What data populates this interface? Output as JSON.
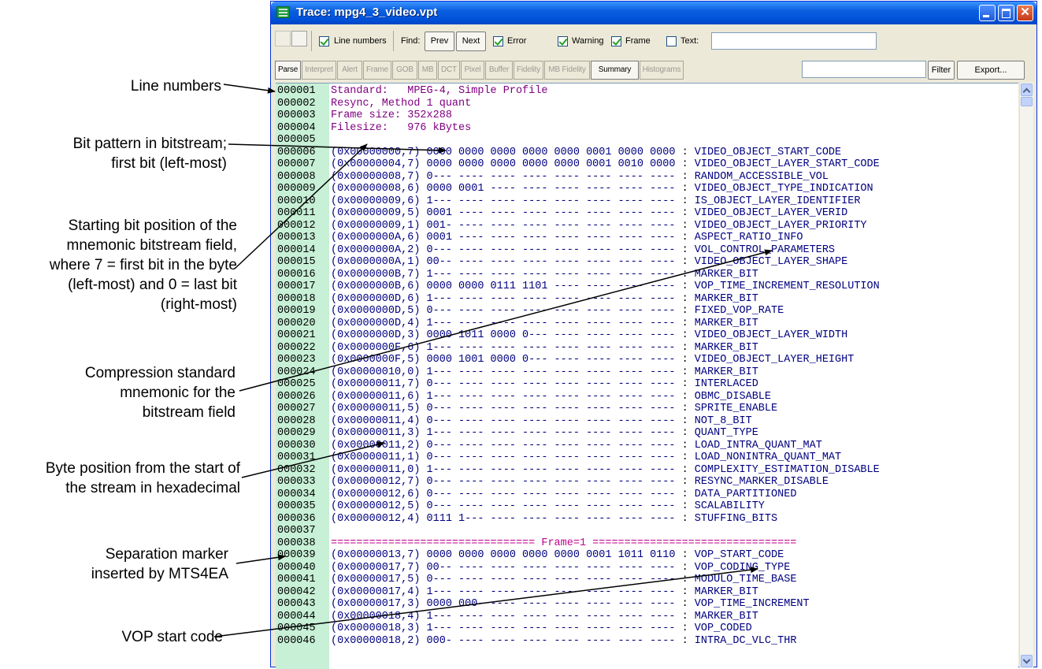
{
  "window": {
    "title": "Trace: mpg4_3_video.vpt",
    "icon": "table-icon",
    "title_color": "#ffffff",
    "titlebar_color": "#0a5fe0"
  },
  "toolbar1": {
    "line_numbers_label": "Line numbers",
    "line_numbers_checked": true,
    "find_label": "Find:",
    "prev_label": "Prev",
    "next_label": "Next",
    "error_label": "Error",
    "error_checked": true,
    "warning_label": "Warning",
    "warning_checked": true,
    "frame_label": "Frame",
    "frame_checked": true,
    "text_label": "Text:",
    "text_checked": false
  },
  "tabs": [
    {
      "label": "Parse",
      "enabled": true
    },
    {
      "label": "Interpret",
      "enabled": false
    },
    {
      "label": "Alert",
      "enabled": false
    },
    {
      "label": "Frame",
      "enabled": false
    },
    {
      "label": "GOB",
      "enabled": false
    },
    {
      "label": "MB",
      "enabled": false
    },
    {
      "label": "DCT",
      "enabled": false
    },
    {
      "label": "Pixel",
      "enabled": false
    },
    {
      "label": "Buffer",
      "enabled": false
    },
    {
      "label": "Fidelity",
      "enabled": false
    },
    {
      "label": "MB Fidelity",
      "enabled": false
    },
    {
      "label": "Summary",
      "enabled": true
    },
    {
      "label": "Histograms",
      "enabled": false
    }
  ],
  "toolbar2": {
    "filter_label": "Filter",
    "export_label": "Export..."
  },
  "header_lines": [
    {
      "num": "000001",
      "text": "Standard:   MPEG-4, Simple Profile"
    },
    {
      "num": "000002",
      "text": "Resync, Method 1 quant"
    },
    {
      "num": "000003",
      "text": "Frame size: 352x288"
    },
    {
      "num": "000004",
      "text": "Filesize:   976 kBytes"
    },
    {
      "num": "000005",
      "text": ""
    }
  ],
  "trace_lines": [
    {
      "num": "000006",
      "off": "(0x00000000,7)",
      "bits": "0000 0000 0000 0000 0000 0001 0000 0000",
      "mnemonic": "VIDEO_OBJECT_START_CODE"
    },
    {
      "num": "000007",
      "off": "(0x00000004,7)",
      "bits": "0000 0000 0000 0000 0000 0001 0010 0000",
      "mnemonic": "VIDEO_OBJECT_LAYER_START_CODE"
    },
    {
      "num": "000008",
      "off": "(0x00000008,7)",
      "bits": "0--- ---- ---- ---- ---- ---- ---- ----",
      "mnemonic": "RANDOM_ACCESSIBLE_VOL"
    },
    {
      "num": "000009",
      "off": "(0x00000008,6)",
      "bits": "0000 0001 ---- ---- ---- ---- ---- ----",
      "mnemonic": "VIDEO_OBJECT_TYPE_INDICATION"
    },
    {
      "num": "000010",
      "off": "(0x00000009,6)",
      "bits": "1--- ---- ---- ---- ---- ---- ---- ----",
      "mnemonic": "IS_OBJECT_LAYER_IDENTIFIER"
    },
    {
      "num": "000011",
      "off": "(0x00000009,5)",
      "bits": "0001 ---- ---- ---- ---- ---- ---- ----",
      "mnemonic": "VIDEO_OBJECT_LAYER_VERID"
    },
    {
      "num": "000012",
      "off": "(0x00000009,1)",
      "bits": "001- ---- ---- ---- ---- ---- ---- ----",
      "mnemonic": "VIDEO_OBJECT_LAYER_PRIORITY"
    },
    {
      "num": "000013",
      "off": "(0x0000000A,6)",
      "bits": "0001 ---- ---- ---- ---- ---- ---- ----",
      "mnemonic": "ASPECT_RATIO_INFO"
    },
    {
      "num": "000014",
      "off": "(0x0000000A,2)",
      "bits": "0--- ---- ---- ---- ---- ---- ---- ----",
      "mnemonic": "VOL_CONTROL_PARAMETERS"
    },
    {
      "num": "000015",
      "off": "(0x0000000A,1)",
      "bits": "00-- ---- ---- ---- ---- ---- ---- ----",
      "mnemonic": "VIDEO_OBJECT_LAYER_SHAPE"
    },
    {
      "num": "000016",
      "off": "(0x0000000B,7)",
      "bits": "1--- ---- ---- ---- ---- ---- ---- ----",
      "mnemonic": "MARKER_BIT"
    },
    {
      "num": "000017",
      "off": "(0x0000000B,6)",
      "bits": "0000 0000 0111 1101 ---- ---- ---- ----",
      "mnemonic": "VOP_TIME_INCREMENT_RESOLUTION"
    },
    {
      "num": "000018",
      "off": "(0x0000000D,6)",
      "bits": "1--- ---- ---- ---- ---- ---- ---- ----",
      "mnemonic": "MARKER_BIT"
    },
    {
      "num": "000019",
      "off": "(0x0000000D,5)",
      "bits": "0--- ---- ---- ---- ---- ---- ---- ----",
      "mnemonic": "FIXED_VOP_RATE"
    },
    {
      "num": "000020",
      "off": "(0x0000000D,4)",
      "bits": "1--- ---- ---- ---- ---- ---- ---- ----",
      "mnemonic": "MARKER_BIT"
    },
    {
      "num": "000021",
      "off": "(0x0000000D,3)",
      "bits": "0000 1011 0000 0--- ---- ---- ---- ----",
      "mnemonic": "VIDEO_OBJECT_LAYER_WIDTH"
    },
    {
      "num": "000022",
      "off": "(0x0000000F,6)",
      "bits": "1--- ---- ---- ---- ---- ---- ---- ----",
      "mnemonic": "MARKER_BIT"
    },
    {
      "num": "000023",
      "off": "(0x0000000F,5)",
      "bits": "0000 1001 0000 0--- ---- ---- ---- ----",
      "mnemonic": "VIDEO_OBJECT_LAYER_HEIGHT"
    },
    {
      "num": "000024",
      "off": "(0x00000010,0)",
      "bits": "1--- ---- ---- ---- ---- ---- ---- ----",
      "mnemonic": "MARKER_BIT"
    },
    {
      "num": "000025",
      "off": "(0x00000011,7)",
      "bits": "0--- ---- ---- ---- ---- ---- ---- ----",
      "mnemonic": "INTERLACED"
    },
    {
      "num": "000026",
      "off": "(0x00000011,6)",
      "bits": "1--- ---- ---- ---- ---- ---- ---- ----",
      "mnemonic": "OBMC_DISABLE"
    },
    {
      "num": "000027",
      "off": "(0x00000011,5)",
      "bits": "0--- ---- ---- ---- ---- ---- ---- ----",
      "mnemonic": "SPRITE_ENABLE"
    },
    {
      "num": "000028",
      "off": "(0x00000011,4)",
      "bits": "0--- ---- ---- ---- ---- ---- ---- ----",
      "mnemonic": "NOT_8_BIT"
    },
    {
      "num": "000029",
      "off": "(0x00000011,3)",
      "bits": "1--- ---- ---- ---- ---- ---- ---- ----",
      "mnemonic": "QUANT_TYPE"
    },
    {
      "num": "000030",
      "off": "(0x00000011,2)",
      "bits": "0--- ---- ---- ---- ---- ---- ---- ----",
      "mnemonic": "LOAD_INTRA_QUANT_MAT"
    },
    {
      "num": "000031",
      "off": "(0x00000011,1)",
      "bits": "0--- ---- ---- ---- ---- ---- ---- ----",
      "mnemonic": "LOAD_NONINTRA_QUANT_MAT"
    },
    {
      "num": "000032",
      "off": "(0x00000011,0)",
      "bits": "1--- ---- ---- ---- ---- ---- ---- ----",
      "mnemonic": "COMPLEXITY_ESTIMATION_DISABLE"
    },
    {
      "num": "000033",
      "off": "(0x00000012,7)",
      "bits": "0--- ---- ---- ---- ---- ---- ---- ----",
      "mnemonic": "RESYNC_MARKER_DISABLE"
    },
    {
      "num": "000034",
      "off": "(0x00000012,6)",
      "bits": "0--- ---- ---- ---- ---- ---- ---- ----",
      "mnemonic": "DATA_PARTITIONED"
    },
    {
      "num": "000035",
      "off": "(0x00000012,5)",
      "bits": "0--- ---- ---- ---- ---- ---- ---- ----",
      "mnemonic": "SCALABILITY"
    },
    {
      "num": "000036",
      "off": "(0x00000012,4)",
      "bits": "0111 1--- ---- ---- ---- ---- ---- ----",
      "mnemonic": "STUFFING_BITS"
    }
  ],
  "blank_line": {
    "num": "000037"
  },
  "frame_separator": {
    "num": "000038",
    "text": "================================ Frame=1 ================================"
  },
  "trace_lines_2": [
    {
      "num": "000039",
      "off": "(0x00000013,7)",
      "bits": "0000 0000 0000 0000 0000 0001 1011 0110",
      "mnemonic": "VOP_START_CODE"
    },
    {
      "num": "000040",
      "off": "(0x00000017,7)",
      "bits": "00-- ---- ---- ---- ---- ---- ---- ----",
      "mnemonic": "VOP_CODING_TYPE"
    },
    {
      "num": "000041",
      "off": "(0x00000017,5)",
      "bits": "0--- ---- ---- ---- ---- ---- ---- ----",
      "mnemonic": "MODULO_TIME_BASE"
    },
    {
      "num": "000042",
      "off": "(0x00000017,4)",
      "bits": "1--- ---- ---- ---- ---- ---- ---- ----",
      "mnemonic": "MARKER_BIT"
    },
    {
      "num": "000043",
      "off": "(0x00000017,3)",
      "bits": "0000 000- ---- ---- ---- ---- ---- ----",
      "mnemonic": "VOP_TIME_INCREMENT"
    },
    {
      "num": "000044",
      "off": "(0x00000018,4)",
      "bits": "1--- ---- ---- ---- ---- ---- ---- ----",
      "mnemonic": "MARKER_BIT"
    },
    {
      "num": "000045",
      "off": "(0x00000018,3)",
      "bits": "1--- ---- ---- ---- ---- ---- ---- ----",
      "mnemonic": "VOP_CODED"
    },
    {
      "num": "000046",
      "off": "(0x00000018,2)",
      "bits": "000- ---- ---- ---- ---- ---- ---- ----",
      "mnemonic": "INTRA_DC_VLC_THR"
    }
  ],
  "callouts": {
    "line_numbers": "Line numbers",
    "bit_pattern_1": "Bit pattern in bitstream;",
    "bit_pattern_2": "first bit (left-most)",
    "start_bit_1": "Starting bit position of the",
    "start_bit_2": "mnemonic bitstream field,",
    "start_bit_3": "where 7 = first bit in the byte",
    "start_bit_4": "(left-most) and 0 = last bit",
    "start_bit_5": "(right-most)",
    "compression_1": "Compression standard",
    "compression_2": "mnemonic for the",
    "compression_3": "bitstream field",
    "byte_pos_1": "Byte position from the start of",
    "byte_pos_2": "the stream in hexadecimal",
    "separation_1": "Separation marker",
    "separation_2": "inserted by MTS4EA",
    "vop_start": "VOP start code"
  }
}
